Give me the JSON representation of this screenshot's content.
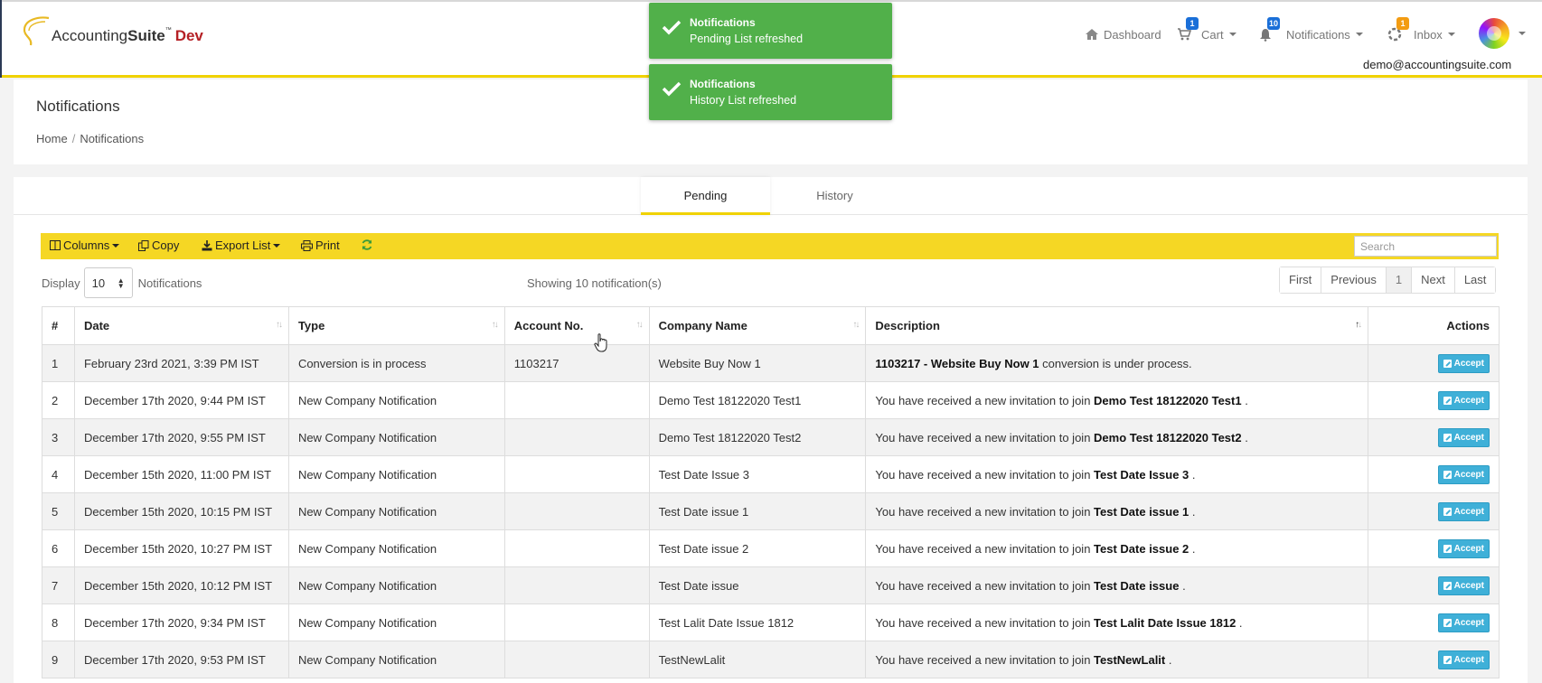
{
  "brand": {
    "name_regular": "Accounting",
    "name_bold": "Suite",
    "tm": "™",
    "env": "Dev"
  },
  "topnav": {
    "dashboard": "Dashboard",
    "cart": "Cart",
    "cart_badge": "1",
    "notifications": "Notifications",
    "notifications_badge": "10",
    "inbox": "Inbox",
    "inbox_badge": "1",
    "user_email": "demo@accountingsuite.com"
  },
  "colors": {
    "accent_yellow": "#f5d724",
    "toast_green": "#51b04a",
    "accept_blue": "#3fb0d8",
    "cart_badge": "#1a6fd8",
    "notif_badge": "#1a6fd8",
    "inbox_badge": "#f39c12"
  },
  "toasts": [
    {
      "title": "Notifications",
      "message": "Pending List refreshed"
    },
    {
      "title": "Notifications",
      "message": "History List refreshed"
    }
  ],
  "page": {
    "title": "Notifications",
    "breadcrumb": [
      "Home",
      "Notifications"
    ]
  },
  "tabs": [
    {
      "label": "Pending",
      "active": true
    },
    {
      "label": "History",
      "active": false
    }
  ],
  "toolbar": {
    "columns": "Columns",
    "copy": "Copy",
    "export": "Export List",
    "print": "Print",
    "search_placeholder": "Search"
  },
  "display": {
    "label": "Display",
    "value": "10",
    "suffix": "Notifications"
  },
  "showing": "Showing 10 notification(s)",
  "pager": [
    "First",
    "Previous",
    "1",
    "Next",
    "Last"
  ],
  "table": {
    "headers": [
      "#",
      "Date",
      "Type",
      "Account No.",
      "Company Name",
      "Description",
      "Actions"
    ],
    "accept_label": "Accept",
    "rows": [
      {
        "n": "1",
        "date": "February 23rd 2021, 3:39 PM IST",
        "type": "Conversion is in process",
        "account": "1103217",
        "company": "Website Buy Now 1",
        "desc_pre": "",
        "desc_bold": "1103217 - Website Buy Now 1",
        "desc_post": " conversion is under process."
      },
      {
        "n": "2",
        "date": "December 17th 2020, 9:44 PM IST",
        "type": "New Company Notification",
        "account": "",
        "company": "Demo Test 18122020 Test1",
        "desc_pre": "You have received a new invitation to join ",
        "desc_bold": "Demo Test 18122020 Test1",
        "desc_post": " ."
      },
      {
        "n": "3",
        "date": "December 17th 2020, 9:55 PM IST",
        "type": "New Company Notification",
        "account": "",
        "company": "Demo Test 18122020 Test2",
        "desc_pre": "You have received a new invitation to join ",
        "desc_bold": "Demo Test 18122020 Test2",
        "desc_post": " ."
      },
      {
        "n": "4",
        "date": "December 15th 2020, 11:00 PM IST",
        "type": "New Company Notification",
        "account": "",
        "company": "Test Date Issue 3",
        "desc_pre": "You have received a new invitation to join ",
        "desc_bold": "Test Date Issue 3",
        "desc_post": " ."
      },
      {
        "n": "5",
        "date": "December 15th 2020, 10:15 PM IST",
        "type": "New Company Notification",
        "account": "",
        "company": "Test Date issue 1",
        "desc_pre": "You have received a new invitation to join ",
        "desc_bold": "Test Date issue 1",
        "desc_post": " ."
      },
      {
        "n": "6",
        "date": "December 15th 2020, 10:27 PM IST",
        "type": "New Company Notification",
        "account": "",
        "company": "Test Date issue 2",
        "desc_pre": "You have received a new invitation to join ",
        "desc_bold": "Test Date issue 2",
        "desc_post": " ."
      },
      {
        "n": "7",
        "date": "December 15th 2020, 10:12 PM IST",
        "type": "New Company Notification",
        "account": "",
        "company": "Test Date issue",
        "desc_pre": "You have received a new invitation to join ",
        "desc_bold": "Test Date issue",
        "desc_post": " ."
      },
      {
        "n": "8",
        "date": "December 17th 2020, 9:34 PM IST",
        "type": "New Company Notification",
        "account": "",
        "company": "Test Lalit Date Issue 1812",
        "desc_pre": "You have received a new invitation to join ",
        "desc_bold": "Test Lalit Date Issue 1812",
        "desc_post": " ."
      },
      {
        "n": "9",
        "date": "December 17th 2020, 9:53 PM IST",
        "type": "New Company Notification",
        "account": "",
        "company": "TestNewLalit",
        "desc_pre": "You have received a new invitation to join ",
        "desc_bold": "TestNewLalit",
        "desc_post": " ."
      }
    ]
  }
}
